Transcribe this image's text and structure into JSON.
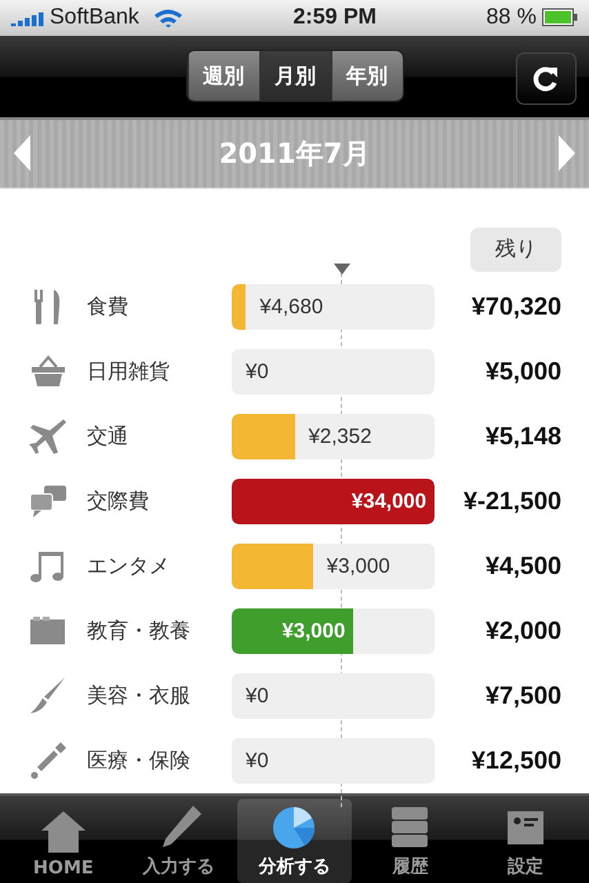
{
  "status_bar": {
    "carrier": "SoftBank",
    "time": "2:59 PM",
    "battery": "88 %"
  },
  "segments": [
    {
      "label": "週別",
      "selected": false
    },
    {
      "label": "月別",
      "selected": true
    },
    {
      "label": "年別",
      "selected": false
    }
  ],
  "period": {
    "title": "2011年7月"
  },
  "remaining_button": "残り",
  "categories": [
    {
      "kind": "food",
      "name": "食費",
      "spent": "¥4,680",
      "level": 0.07,
      "color": "#f4b733",
      "remaining": "¥70,320"
    },
    {
      "kind": "basket",
      "name": "日用雑貨",
      "spent": "¥0",
      "remaining": "¥5,000"
    },
    {
      "kind": "plane",
      "name": "交通",
      "spent": "¥2,352",
      "level": 0.31,
      "color": "#f4b733",
      "remaining": "¥5,148"
    },
    {
      "kind": "chat",
      "name": "交際費",
      "spent": "¥34,000",
      "level": 1,
      "color": "#b8141a",
      "remaining": "¥-21,500"
    },
    {
      "kind": "music",
      "name": "エンタメ",
      "spent": "¥3,000",
      "level": 0.4,
      "color": "#f4b733",
      "remaining": "¥4,500"
    },
    {
      "kind": "folder",
      "name": "教育・教養",
      "spent": "¥3,000",
      "level": 0.6,
      "color": "#3f9e2c",
      "remaining": "¥2,000"
    },
    {
      "kind": "brush",
      "name": "美容・衣服",
      "spent": "¥0",
      "remaining": "¥7,500"
    },
    {
      "kind": "dropper",
      "name": "医療・保険",
      "spent": "¥0",
      "remaining": "¥12,500"
    }
  ],
  "tabs": [
    {
      "kind": "home",
      "label": "HOME",
      "selected": false
    },
    {
      "kind": "pen",
      "label": "入力する",
      "selected": false
    },
    {
      "kind": "pie",
      "label": "分析する",
      "selected": true
    },
    {
      "kind": "list",
      "label": "履歴",
      "selected": false
    },
    {
      "kind": "card",
      "label": "設定",
      "selected": false
    }
  ]
}
